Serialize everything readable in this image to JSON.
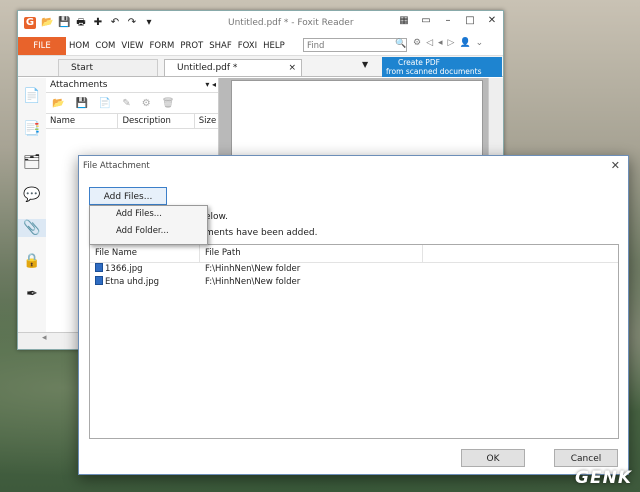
{
  "app": {
    "window_title": "Untitled.pdf * - Foxit Reader",
    "menu": {
      "file": "FILE",
      "items": [
        "HOM",
        "COM",
        "VIEW",
        "FORM",
        "PROT",
        "SHAF",
        "FOXI",
        "HELP"
      ]
    },
    "find_placeholder": "Find",
    "tabs": {
      "start": "Start",
      "doc": "Untitled.pdf *",
      "close_glyph": "×"
    },
    "promo": {
      "line1": "Create PDF",
      "line2": "from scanned documents"
    },
    "attachments_panel": {
      "title": "Attachments",
      "columns": {
        "name": "Name",
        "description": "Description",
        "size": "Size"
      }
    }
  },
  "dialog": {
    "title": "File Attachment",
    "add_files_button": "Add Files...",
    "dropdown": {
      "add_files": "Add Files...",
      "add_folder": "Add Folder..."
    },
    "hint1": "elow.",
    "hint2": "ments have been added.",
    "columns": {
      "file_name": "File Name",
      "file_path": "File Path"
    },
    "files": [
      {
        "name": "1366.jpg",
        "path": "F:\\HinhNen\\New folder"
      },
      {
        "name": "Etna uhd.jpg",
        "path": "F:\\HinhNen\\New folder"
      }
    ],
    "ok": "OK",
    "cancel": "Cancel"
  },
  "watermark": "GENK"
}
